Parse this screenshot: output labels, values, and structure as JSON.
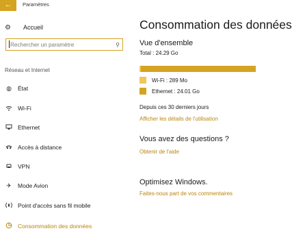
{
  "window": {
    "title": "Paramètres",
    "back_glyph": "←"
  },
  "sidebar": {
    "home_label": "Accueil",
    "search_placeholder": "Rechercher un paramètre",
    "section_header": "Réseau et Internet",
    "items": [
      {
        "label": "État",
        "icon": "globe-icon"
      },
      {
        "label": "Wi-Fi",
        "icon": "wifi-icon"
      },
      {
        "label": "Ethernet",
        "icon": "ethernet-icon"
      },
      {
        "label": "Accès à distance",
        "icon": "dialup-icon"
      },
      {
        "label": "VPN",
        "icon": "vpn-icon"
      },
      {
        "label": "Mode Avion",
        "icon": "airplane-icon"
      },
      {
        "label": "Point d'accès sans fil mobile",
        "icon": "hotspot-icon"
      },
      {
        "label": "Consommation des données",
        "icon": "data-usage-icon",
        "active": true
      }
    ]
  },
  "main": {
    "title": "Consommation des données",
    "overview_title": "Vue d'ensemble",
    "total": "Total : 24.29 Go",
    "usage_wifi_fraction": 0.012,
    "legend": [
      {
        "label": "Wi-Fi : 289 Mo",
        "color": "#f1c65a"
      },
      {
        "label": "Ethernet : 24.01 Go",
        "color": "#d4a321"
      }
    ],
    "period": "Depuis ces 30 derniers jours",
    "details_link": "Afficher les détails de l'utilisation",
    "questions_title": "Vous avez des questions ?",
    "help_link": "Obtenir de l'aide",
    "improve_title": "Optimisez Windows.",
    "feedback_link": "Faites-nous part de vos commentaires"
  },
  "colors": {
    "accent": "#d4a321",
    "link": "#b8860b"
  }
}
